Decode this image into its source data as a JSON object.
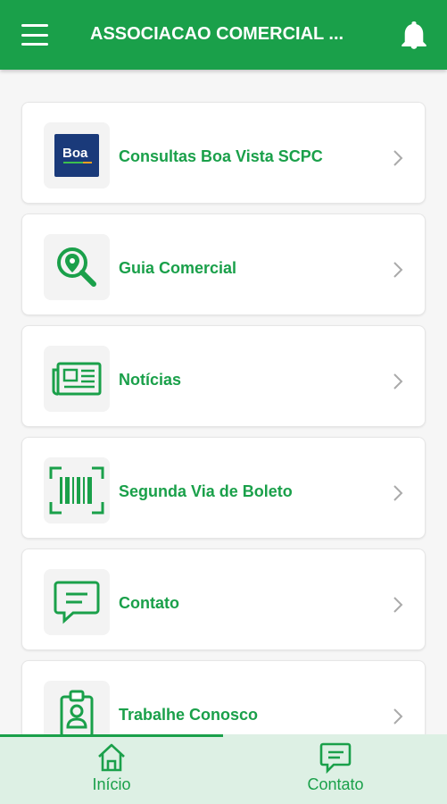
{
  "header": {
    "title": "ASSOCIACAO COMERCIAL ...",
    "menu_icon": "menu-icon",
    "bell_icon": "bell-icon"
  },
  "items": [
    {
      "label": "Consultas Boa Vista SCPC",
      "icon": "boa-vista-logo",
      "logo_text": "Boa"
    },
    {
      "label": "Guia Comercial",
      "icon": "map-search-icon"
    },
    {
      "label": "Notícias",
      "icon": "newspaper-icon"
    },
    {
      "label": "Segunda Via de Boleto",
      "icon": "barcode-icon"
    },
    {
      "label": "Contato",
      "icon": "chat-icon"
    },
    {
      "label": "Trabalhe Conosco",
      "icon": "badge-icon"
    }
  ],
  "bottom_nav": [
    {
      "label": "Início",
      "icon": "home-icon",
      "active": true
    },
    {
      "label": "Contato",
      "icon": "chat-icon",
      "active": false
    }
  ],
  "colors": {
    "primary": "#1aa04a",
    "background": "#f6f6f6",
    "bottom_nav_bg": "#ddf0e4",
    "chevron": "#aaaaaa"
  }
}
